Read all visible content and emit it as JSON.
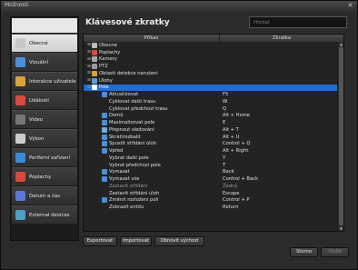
{
  "window": {
    "title": "Možnosti",
    "close": "✕"
  },
  "sidebar": {
    "items": [
      {
        "label": "Obecné",
        "icon": "general-icon",
        "color": "#c8c8c8",
        "selected": true
      },
      {
        "label": "Vizuální",
        "icon": "visual-icon",
        "color": "#4a90d9"
      },
      {
        "label": "Interakce uživatele",
        "icon": "user-interaction-icon",
        "color": "#d9a23a"
      },
      {
        "label": "Události",
        "icon": "events-icon",
        "color": "#d9483a"
      },
      {
        "label": "Video",
        "icon": "video-icon",
        "color": "#777777"
      },
      {
        "label": "Výkon",
        "icon": "performance-icon",
        "color": "#cccccc"
      },
      {
        "label": "Periferní zařízení",
        "icon": "peripherals-icon",
        "color": "#3a8ad9"
      },
      {
        "label": "Poplachy",
        "icon": "alarms-icon",
        "color": "#d94a3a"
      },
      {
        "label": "Datum a čas",
        "icon": "datetime-icon",
        "color": "#5a7ad9"
      },
      {
        "label": "External devices",
        "icon": "external-devices-icon",
        "color": "#4aa0c8"
      }
    ]
  },
  "main": {
    "title": "Klávesové zkratky",
    "search_placeholder": "Hledat",
    "columns": [
      "Příkaz",
      "Zkratka"
    ],
    "rows": [
      {
        "label": "Obecné",
        "shortcut": "",
        "level": 0,
        "expand": "⊞",
        "icon": "folder-icon",
        "color": "#bbbbbb"
      },
      {
        "label": "Poplachy",
        "shortcut": "",
        "level": 0,
        "expand": "⊞",
        "icon": "alarm-icon",
        "color": "#d9483a"
      },
      {
        "label": "Kamery",
        "shortcut": "",
        "level": 0,
        "expand": "⊞",
        "icon": "camera-icon",
        "color": "#aaaaaa"
      },
      {
        "label": "PTZ",
        "shortcut": "",
        "level": 0,
        "expand": "⊞",
        "icon": "ptz-icon",
        "color": "#999999"
      },
      {
        "label": "Oblasti detekce narušení",
        "shortcut": "",
        "level": 0,
        "expand": "⊞",
        "icon": "detection-icon",
        "color": "#d9a23a"
      },
      {
        "label": "Úlohy",
        "shortcut": "",
        "level": 0,
        "expand": "⊞",
        "icon": "task-icon",
        "color": "#5aa0d9"
      },
      {
        "label": "Pole",
        "shortcut": "",
        "level": 0,
        "expand": "⊟",
        "icon": "tile-icon",
        "color": "#ffffff",
        "selected": true
      },
      {
        "label": "Aktualizovat",
        "shortcut": "F5",
        "level": 1,
        "icon": "refresh-icon",
        "color": "#4a90d9"
      },
      {
        "label": "Cyklovat další trasu",
        "shortcut": "W",
        "level": 1,
        "icon": "",
        "color": ""
      },
      {
        "label": "Cyklovat předchozí trasu",
        "shortcut": "Q",
        "level": 1,
        "icon": "",
        "color": ""
      },
      {
        "label": "Domů",
        "shortcut": "Alt + Home",
        "level": 1,
        "icon": "home-icon",
        "color": "#4a90d9"
      },
      {
        "label": "Maximalizovat pole",
        "shortcut": "E",
        "level": 1,
        "icon": "maximize-icon",
        "color": "#4a90d9"
      },
      {
        "label": "Přepnout sledování",
        "shortcut": "Alt + T",
        "level": 1,
        "icon": "tracking-icon",
        "color": "#6ab0e0"
      },
      {
        "label": "Skrát/rozbalit",
        "shortcut": "Alt + U",
        "level": 1,
        "icon": "collapse-icon",
        "color": "#4a90d9"
      },
      {
        "label": "Spustit střídání úloh",
        "shortcut": "Control + Q",
        "level": 1,
        "icon": "play-icon",
        "color": "#4a90d9"
      },
      {
        "label": "Vpřed",
        "shortcut": "Alt + Right",
        "level": 1,
        "icon": "forward-icon",
        "color": "#4a90d9"
      },
      {
        "label": "Vybrat další pole",
        "shortcut": "Y",
        "level": 1,
        "icon": "",
        "color": ""
      },
      {
        "label": "Vybrat předchozí pole",
        "shortcut": "T",
        "level": 1,
        "icon": "",
        "color": ""
      },
      {
        "label": "Vymazat",
        "shortcut": "Back",
        "level": 1,
        "icon": "clear-icon",
        "color": "#4a90d9"
      },
      {
        "label": "Vymazat vše",
        "shortcut": "Control + Back",
        "level": 1,
        "icon": "clear-all-icon",
        "color": "#4a90d9"
      },
      {
        "label": "Zastavit střídání",
        "shortcut": "Žádný",
        "level": 1,
        "icon": "",
        "color": "",
        "dim": true
      },
      {
        "label": "Zastavit střídání úloh",
        "shortcut": "Escape",
        "level": 1,
        "icon": "",
        "color": ""
      },
      {
        "label": "Změnit rozložení polí",
        "shortcut": "Control + P",
        "level": 1,
        "icon": "layout-icon",
        "color": "#4a90d9"
      },
      {
        "label": "Zobrazit entitu",
        "shortcut": "Return",
        "level": 1,
        "icon": "",
        "color": "",
        "italic": true
      }
    ]
  },
  "buttons": {
    "export": "Exportovat",
    "import": "Importovat",
    "restore": "Obnovit výchozí",
    "cancel": "Storno",
    "save": "Uložit"
  }
}
